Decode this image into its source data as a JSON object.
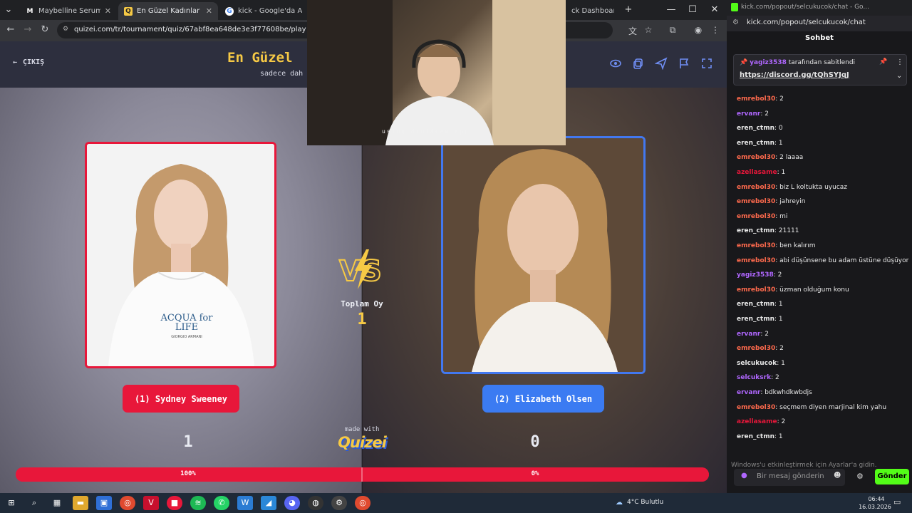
{
  "browser": {
    "tabs": [
      {
        "label": "Maybelline Serum Lipstick",
        "icon": "M"
      },
      {
        "label": "En Güzel Kadınlar (Güncel)",
        "icon": "Q"
      },
      {
        "label": "kick - Google'da Ara",
        "icon": "G"
      },
      {
        "label": "ck Dashboard",
        "icon": ""
      }
    ],
    "new_tab": "+",
    "url": "quizei.com/tr/tournament/quiz/67abf8ea648de3e3f77608be/play"
  },
  "quiz": {
    "title": "En Güzel",
    "subtitle": "sadece dah",
    "exit_label": "ÇIKIŞ",
    "header_icons": [
      "eye-icon",
      "copy-icon",
      "send-icon",
      "flag-icon",
      "fullscreen-icon"
    ],
    "contestants": [
      {
        "label": "(1) Sydney Sweeney",
        "votes": "1",
        "percent": "100%",
        "shirt_text": "ACQUA for LIFE",
        "shirt_brand": "GIORGIO ARMANI"
      },
      {
        "label": "(2) Elizabeth Olsen",
        "votes": "0",
        "percent": "0%"
      }
    ],
    "progress_fraction": 1.0,
    "total_label": "Toplam Oy",
    "total_value": "1",
    "made_with": "made with",
    "brand": "Quizei",
    "colors": {
      "red": "#e8173a",
      "blue": "#3b7bf2",
      "gold": "#f6c945"
    }
  },
  "webcam": {
    "caption": "using droidcam.app"
  },
  "chat": {
    "window_title": "kick.com/popout/selcukucok/chat - Go...",
    "url": "kick.com/popout/selcukucok/chat",
    "heading": "Sohbet",
    "pinned": {
      "by": "yagiz3538",
      "by_suffix": "tarafından sabitlendi",
      "link": "https://discord.gg/tQhSYJqJ"
    },
    "messages": [
      {
        "user": "emrebol30",
        "text": ": 2",
        "color": "#ff6a4d"
      },
      {
        "user": "ervanr",
        "text": ": 2",
        "color": "#b067ff"
      },
      {
        "user": "eren_ctmn",
        "text": ": 0",
        "color": "#e8e8e8"
      },
      {
        "user": "eren_ctmn",
        "text": ": 1",
        "color": "#e8e8e8"
      },
      {
        "user": "emrebol30",
        "text": ": 2 laaaa",
        "color": "#ff6a4d"
      },
      {
        "user": "azellasame",
        "text": ": 1",
        "color": "#e8173a"
      },
      {
        "user": "emrebol30",
        "text": ": biz L koltukta uyucaz",
        "color": "#ff6a4d"
      },
      {
        "user": "emrebol30",
        "text": ": jahreyin",
        "color": "#ff6a4d"
      },
      {
        "user": "emrebol30",
        "text": ": mi",
        "color": "#ff6a4d"
      },
      {
        "user": "eren_ctmn",
        "text": ": 21111",
        "color": "#e8e8e8"
      },
      {
        "user": "emrebol30",
        "text": ": ben kalırım",
        "color": "#ff6a4d"
      },
      {
        "user": "emrebol30",
        "text": ": abi düşünsene bu adam üstüne düşüyor",
        "color": "#ff6a4d"
      },
      {
        "user": "yagiz3538",
        "text": ": 2",
        "color": "#b067ff"
      },
      {
        "user": "emrebol30",
        "text": ": üzman olduğum konu",
        "color": "#ff6a4d"
      },
      {
        "user": "eren_ctmn",
        "text": ": 1",
        "color": "#e8e8e8"
      },
      {
        "user": "eren_ctmn",
        "text": ": 1",
        "color": "#e8e8e8"
      },
      {
        "user": "ervanr",
        "text": ": 2",
        "color": "#b067ff"
      },
      {
        "user": "emrebol30",
        "text": ": 2",
        "color": "#ff6a4d"
      },
      {
        "user": "selcukucok",
        "text": ": 1",
        "color": "#e8e8e8"
      },
      {
        "user": "selcuksrk",
        "text": ": 2",
        "color": "#b067ff"
      },
      {
        "user": "ervanr",
        "text": ": bdkwhdkwbdjs",
        "color": "#b067ff"
      },
      {
        "user": "emrebol30",
        "text": ": seçmem diyen marjinal kim yahu",
        "color": "#ff6a4d"
      },
      {
        "user": "azellasame",
        "text": ": 2",
        "color": "#e8173a"
      },
      {
        "user": "eren_ctmn",
        "text": ": 1",
        "color": "#e8e8e8"
      }
    ],
    "input_placeholder": "Bir mesaj gönderin",
    "send_label": "Gönder",
    "windows_notice": "Windows'u etkinleştirmek için Ayarlar'a gidin."
  },
  "taskbar": {
    "weather": "4°C Bulutlu",
    "time": "06:44",
    "date": "16.03.2026"
  }
}
